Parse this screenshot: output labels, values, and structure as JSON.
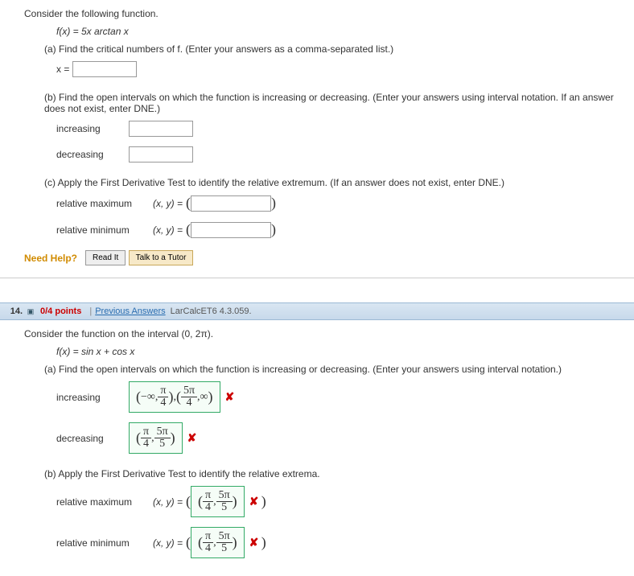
{
  "q13": {
    "intro": "Consider the following function.",
    "func": "f(x) = 5x arctan x",
    "partA": "(a) Find the critical numbers of f. (Enter your answers as a comma-separated list.)",
    "xEq": "x =",
    "partB": "(b) Find the open intervals on which the function is increasing or decreasing. (Enter your answers using interval notation. If an answer does not exist, enter DNE.)",
    "increasing": "increasing",
    "decreasing": "decreasing",
    "partC": "(c) Apply the First Derivative Test to identify the relative extremum. (If an answer does not exist, enter DNE.)",
    "relMax": "relative maximum",
    "relMin": "relative minimum",
    "xyEq": "(x, y) ="
  },
  "needHelp": {
    "label": "Need Help?",
    "read": "Read It",
    "tutor": "Talk to a Tutor"
  },
  "q14": {
    "num": "14.",
    "points": "0/4 points",
    "prev": "Previous Answers",
    "source": "LarCalcET6 4.3.059.",
    "intro": "Consider the function on the interval (0, 2π).",
    "func": "f(x) = sin x + cos x",
    "partA": "(a) Find the open intervals on which the function is increasing or decreasing. (Enter your answers using interval notation.)",
    "increasing": "increasing",
    "decreasing": "decreasing",
    "partB": "(b) Apply the First Derivative Test to identify the relative extrema.",
    "relMax": "relative maximum",
    "relMin": "relative minimum",
    "xyEq": "(x, y) =",
    "ans": {
      "incr": {
        "left": "−∞,",
        "leftNum": "π",
        "leftDen": "4",
        "rightNum": "5π",
        "rightDen": "4",
        "right": ",∞"
      },
      "decr": {
        "num1": "π",
        "den1": "4",
        "num2": "5π",
        "den2": "5"
      },
      "max": {
        "num1": "π",
        "den1": "4",
        "num2": "5π",
        "den2": "5"
      },
      "min": {
        "num1": "π",
        "den1": "4",
        "num2": "5π",
        "den2": "5"
      }
    },
    "wrong": "✘"
  }
}
